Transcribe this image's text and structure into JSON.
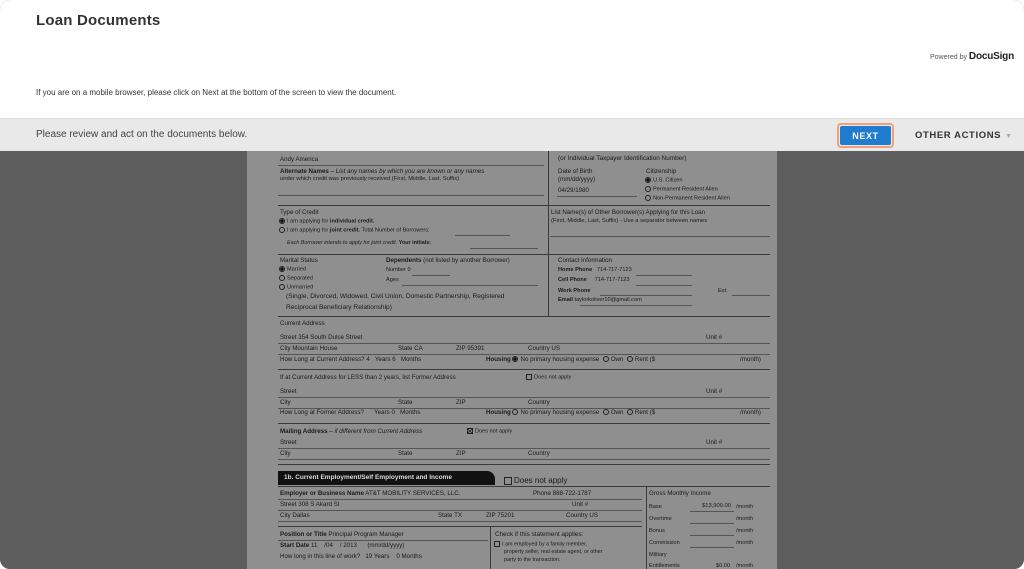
{
  "header": {
    "title": "Loan Documents",
    "powered_prefix": "Powered by",
    "powered_brand": "DocuSign",
    "notice": "If you are on a mobile browser, please click on Next at the bottom of the screen to view the document."
  },
  "actionbar": {
    "review_text": "Please review and act on the documents below.",
    "next_label": "NEXT",
    "other_actions_label": "OTHER ACTIONS"
  },
  "doc": {
    "name_value": "Andy America",
    "alt_names_label": "Alternate Names",
    "alt_names_hint": "– List any names by which you are known or any names",
    "alt_names_hint2": "under which credit was previously received (First, Middle, Last, Suffix)",
    "tin_hint": "(or Individual Taxpayer Identification Number)",
    "dob_label": "Date of Birth",
    "dob_format": "(mm/dd/yyyy)",
    "dob_value": "04/29/1980",
    "citizenship_label": "Citizenship",
    "cit_1": "U.S. Citizen",
    "cit_2": "Permanent Resident Alien",
    "cit_3": "Non-Permanent Resident Alien",
    "type_credit_label": "Type of Credit",
    "tc_1a": "I am applying for ",
    "tc_1b": "individual credit.",
    "tc_2a": "I am applying for ",
    "tc_2b": "joint credit.",
    "tc_2c": " Total Number of Borrowers:",
    "tc_3": "Each Borrower intends to apply for joint credit. ",
    "tc_3b": "Your initials:",
    "list_names_label": "List Name(s) of Other Borrower(s) Applying for this Loan",
    "list_names_hint": "(First, Middle, Last, Suffix) - Use a separator between names",
    "marital_label": "Marital Status",
    "mar_1": "Married",
    "mar_2": "Separated",
    "mar_3": "Unmarried",
    "mar_hint1": "(Single, Divorced, Widowed, Civil Union, Domestic Partnership, Registered",
    "mar_hint2": "Reciprocal Beneficiary Relationship)",
    "dependents_label": "Dependents",
    "dependents_hint": "(not listed by another Borrower)",
    "dep_number": "Number",
    "dep_number_value": "0",
    "dep_ages": "Ages",
    "contact_label": "Contact Information",
    "home_phone_label": "Home Phone",
    "home_phone": "714-717-7123",
    "cell_phone_label": "Cell Phone",
    "cell_phone": "714-717-7123",
    "work_phone_label": "Work Phone",
    "ext_label": "Ext.",
    "email_label": "Email",
    "email": "taylorkoliver10@gmail.com",
    "current_address_label": "Current Address",
    "street_label": "Street",
    "street_value": "354 South Dulce Street",
    "unit_label": "Unit #",
    "city_label": "City",
    "city_value": "Mountain House",
    "state_label": "State",
    "state_value": "CA",
    "zip_label": "ZIP",
    "zip_value": "95391",
    "country_label": "Country",
    "country_value": "US",
    "how_long_label": "How Long at Current Address?",
    "years_value": "4",
    "years_label": "Years",
    "months_value": "6",
    "months_label": "Months",
    "housing_label": "Housing",
    "no_housing": "No primary housing expense",
    "own": "Own",
    "rent": "Rent ($",
    "per_month": "/month)",
    "former_label": "If at Current Address for LESS than 2 years, list Former Address",
    "does_not_apply": "Does not apply",
    "how_long_former_label": "How Long at Former Address?",
    "former_months_value": "0",
    "mailing_label": "Mailing Address",
    "mailing_hint": "– if different from Current Address",
    "section_1b": "1b. Current Employment/Self Employment and Income",
    "section_1b_dna": "Does not apply",
    "employer_label": "Employer or Business Name",
    "employer_value": "AT&T MOBILITY SERVICES, LLC.",
    "phone_label": "Phone",
    "employer_phone": "888-722-1787",
    "emp_street": "308 S Akard St",
    "emp_city": "Dallas",
    "emp_state": "TX",
    "emp_zip": "75201",
    "gross_income_label": "Gross Monthly Income",
    "base_label": "Base",
    "base_value": "$13,900.00",
    "month_label": "/month",
    "overtime_label": "Overtime",
    "bonus_label": "Bonus",
    "commission_label": "Commission",
    "military_label": "Military",
    "entitlements_label": "Entitlements",
    "entitlements_value": "$0.00",
    "position_label": "Position or Title",
    "position_value": "Principal Program Manager",
    "start_date_label": "Start Date",
    "start_mm": "11",
    "start_dd": "04",
    "start_yyyy": "2013",
    "line_work_label": "How long in this line of work?",
    "line_years": "19",
    "line_months": "0",
    "check_statement_label": "Check if this statement applies:",
    "check_statement_1": "I am employed by a family member,",
    "check_statement_2": "property seller, real estate agent, or other",
    "check_statement_3": "party to the transaction."
  }
}
